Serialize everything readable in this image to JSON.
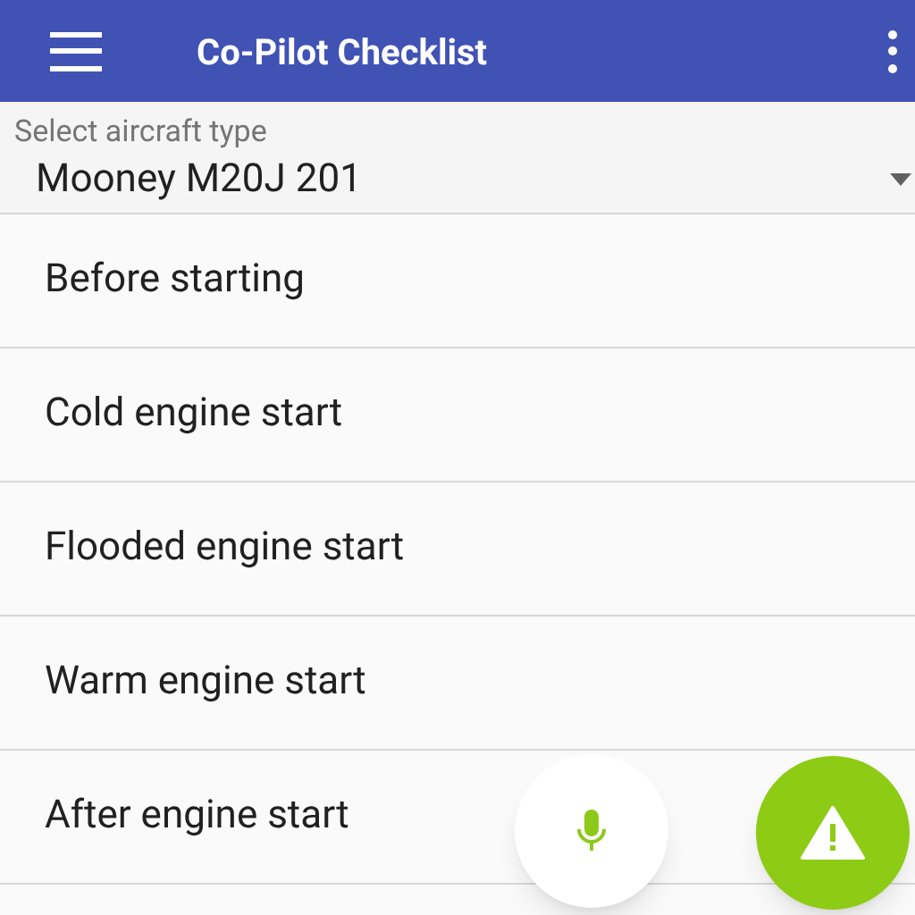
{
  "app_bar": {
    "title": "Co-Pilot Checklist"
  },
  "aircraft_select": {
    "label": "Select aircraft type",
    "value": "Mooney M20J 201"
  },
  "checklists": [
    {
      "label": "Before starting"
    },
    {
      "label": "Cold engine start"
    },
    {
      "label": "Flooded engine start"
    },
    {
      "label": "Warm engine start"
    },
    {
      "label": "After engine start"
    }
  ]
}
